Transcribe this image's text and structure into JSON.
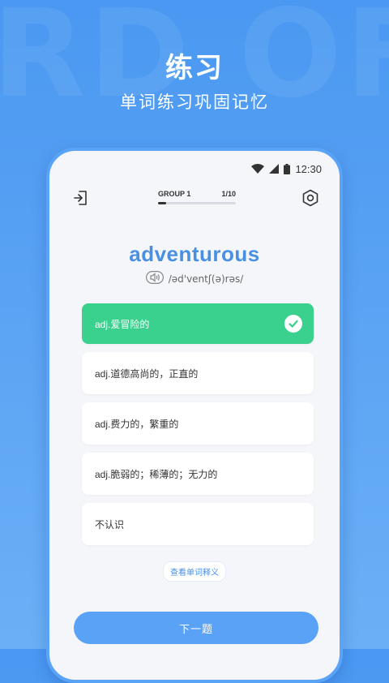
{
  "hero": {
    "title": "练习",
    "subtitle": "单词练习巩固记忆",
    "watermark": "RD OF"
  },
  "status_bar": {
    "time": "12:30"
  },
  "progress": {
    "group_label": "GROUP 1",
    "counter": "1/10",
    "fraction": 0.1
  },
  "word": {
    "text": "adventurous",
    "phonetic": "/əd'ventʃ(ə)rəs/"
  },
  "options": [
    {
      "label": "adj.爱冒险的",
      "state": "correct"
    },
    {
      "label": "adj.道德高尚的，正直的",
      "state": "normal"
    },
    {
      "label": "adj.费力的，繁重的",
      "state": "normal"
    },
    {
      "label": "adj.脆弱的；稀薄的；无力的",
      "state": "normal"
    },
    {
      "label": "不认识",
      "state": "normal"
    }
  ],
  "view_definition_label": "查看单词释义",
  "next_button_label": "下一题",
  "colors": {
    "accent": "#4a90e2",
    "correct": "#3ad08d",
    "background": "#4a98f2"
  }
}
